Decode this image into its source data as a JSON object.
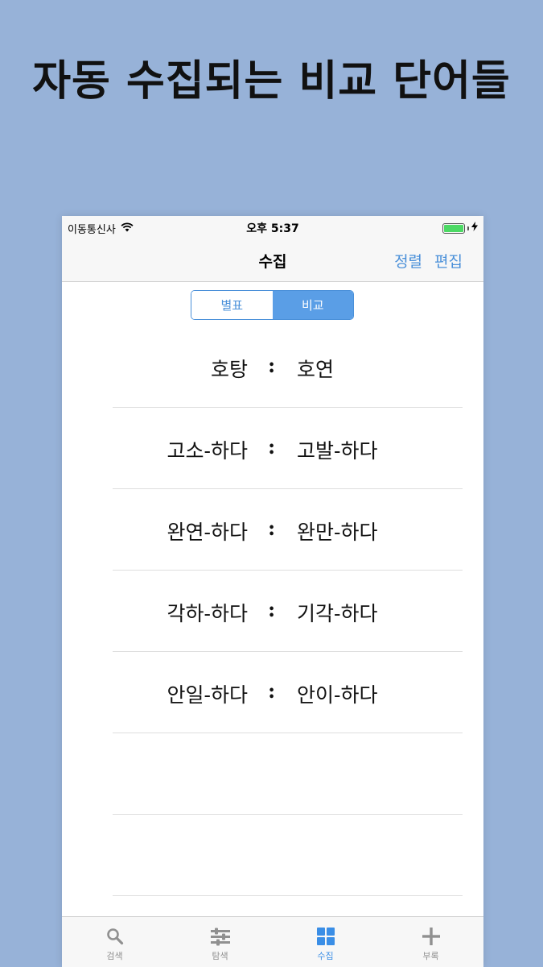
{
  "headline": "자동 수집되는 비교 단어들",
  "status_bar": {
    "carrier": "이동통신사",
    "time": "오후 5:37",
    "wifi_icon": "wifi-icon",
    "battery_icon": "battery-full-icon",
    "charging_icon": "bolt-icon",
    "battery_color": "#4cd964"
  },
  "nav": {
    "title": "수집",
    "sort_label": "정렬",
    "edit_label": "편집",
    "accent_color": "#4a90d9"
  },
  "segments": [
    {
      "label": "별표",
      "selected": false
    },
    {
      "label": "비교",
      "selected": true
    }
  ],
  "rows": [
    {
      "left": "호탕",
      "sep": ":",
      "right": "호연"
    },
    {
      "left": "고소-하다",
      "sep": ":",
      "right": "고발-하다"
    },
    {
      "left": "완연-하다",
      "sep": ":",
      "right": "완만-하다"
    },
    {
      "left": "각하-하다",
      "sep": ":",
      "right": "기각-하다"
    },
    {
      "left": "안일-하다",
      "sep": ":",
      "right": "안이-하다"
    },
    {
      "left": "",
      "sep": "",
      "right": ""
    },
    {
      "left": "",
      "sep": "",
      "right": ""
    }
  ],
  "tabs": [
    {
      "label": "검색",
      "icon": "search-icon",
      "active": false
    },
    {
      "label": "탐색",
      "icon": "sliders-icon",
      "active": false
    },
    {
      "label": "수집",
      "icon": "grid-icon",
      "active": true
    },
    {
      "label": "부록",
      "icon": "plus-icon",
      "active": false
    }
  ]
}
